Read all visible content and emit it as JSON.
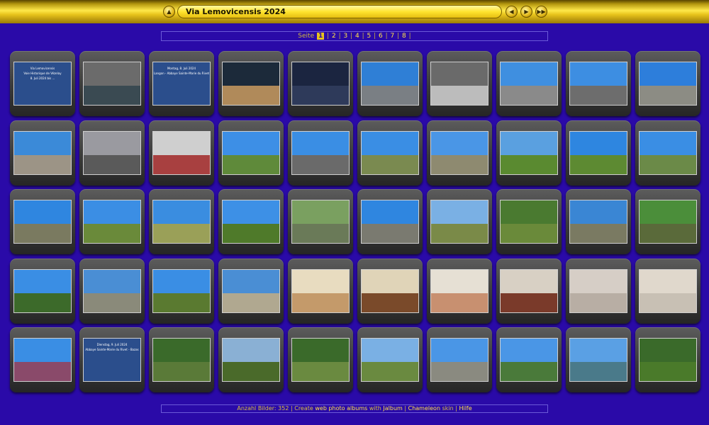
{
  "header": {
    "title": "Via Lemovicensis 2024",
    "up_icon": "up-arrow-icon",
    "prev_icon": "previous-icon",
    "play_icon": "play-icon",
    "next_icon": "next-icon"
  },
  "pager": {
    "label": "Seite",
    "current": "1",
    "pages": [
      "2",
      "3",
      "4",
      "5",
      "6",
      "7",
      "8"
    ]
  },
  "thumbnails": [
    {
      "kind": "title",
      "lines": [
        "Via Lemovicensis",
        "Voie Historique de Vézelay",
        "8. Juli 2024 bis ..."
      ],
      "sky": "#2b4e8c",
      "ground": "#2b4e8c"
    },
    {
      "kind": "photo",
      "sky": "#6b6b6b",
      "ground": "#3a4a52"
    },
    {
      "kind": "title",
      "lines": [
        "Montag, 8. Juli 2024",
        "Langon - Abbaye Sainte-Marie du Rivet"
      ],
      "sky": "#2b4e8c",
      "ground": "#2b4e8c"
    },
    {
      "kind": "photo",
      "sky": "#1c2a3a",
      "ground": "#b08a5a"
    },
    {
      "kind": "photo",
      "sky": "#1b2540",
      "ground": "#2e3a5a"
    },
    {
      "kind": "photo",
      "sky": "#2f7fd6",
      "ground": "#7a7f84"
    },
    {
      "kind": "photo",
      "sky": "#6a6a6a",
      "ground": "#bcbcbc"
    },
    {
      "kind": "photo",
      "sky": "#3f8fe0",
      "ground": "#8a8a8a"
    },
    {
      "kind": "photo",
      "sky": "#3d8ee2",
      "ground": "#6d6d6d"
    },
    {
      "kind": "photo",
      "sky": "#2d7edb",
      "ground": "#8c8c84"
    },
    {
      "kind": "photo",
      "sky": "#3b8ad8",
      "ground": "#9c9486"
    },
    {
      "kind": "photo",
      "sky": "#9a9aa0",
      "ground": "#5a5a5a"
    },
    {
      "kind": "photo",
      "sky": "#cfcfcf",
      "ground": "#a84040"
    },
    {
      "kind": "photo",
      "sky": "#3d8fe6",
      "ground": "#5f8a3a"
    },
    {
      "kind": "photo",
      "sky": "#3a8ee4",
      "ground": "#6a6a6a"
    },
    {
      "kind": "photo",
      "sky": "#3a8ee4",
      "ground": "#7a8a50"
    },
    {
      "kind": "photo",
      "sky": "#4a96e6",
      "ground": "#8e8a70"
    },
    {
      "kind": "photo",
      "sky": "#5aa0e0",
      "ground": "#5a8a30"
    },
    {
      "kind": "photo",
      "sky": "#2e86e0",
      "ground": "#5d8a32"
    },
    {
      "kind": "photo",
      "sky": "#3a8ee4",
      "ground": "#6b8a48"
    },
    {
      "kind": "photo",
      "sky": "#2f86e0",
      "ground": "#7a7a60"
    },
    {
      "kind": "photo",
      "sky": "#3b8ee4",
      "ground": "#6a8a3a"
    },
    {
      "kind": "photo",
      "sky": "#3a8de0",
      "ground": "#9aa058"
    },
    {
      "kind": "photo",
      "sky": "#3d90e6",
      "ground": "#4f7a2a"
    },
    {
      "kind": "photo",
      "sky": "#7aa060",
      "ground": "#6a7a58"
    },
    {
      "kind": "photo",
      "sky": "#2f86e0",
      "ground": "#7a7a70"
    },
    {
      "kind": "photo",
      "sky": "#7ab0e4",
      "ground": "#7a8a48"
    },
    {
      "kind": "photo",
      "sky": "#4a7a30",
      "ground": "#6a8a3a"
    },
    {
      "kind": "photo",
      "sky": "#3a86d4",
      "ground": "#7a7a62"
    },
    {
      "kind": "photo",
      "sky": "#4b8e3a",
      "ground": "#5a6a3a"
    },
    {
      "kind": "photo",
      "sky": "#3a8ee4",
      "ground": "#3c6a2a"
    },
    {
      "kind": "photo",
      "sky": "#4a8ed4",
      "ground": "#8a8a7a"
    },
    {
      "kind": "photo",
      "sky": "#3a8ee4",
      "ground": "#5a7a30"
    },
    {
      "kind": "photo",
      "sky": "#4a8ed4",
      "ground": "#b0a890"
    },
    {
      "kind": "photo",
      "sky": "#e8dcc0",
      "ground": "#c49a6a"
    },
    {
      "kind": "photo",
      "sky": "#e0d4b8",
      "ground": "#7a4a2a"
    },
    {
      "kind": "photo",
      "sky": "#e6e0d4",
      "ground": "#c89070"
    },
    {
      "kind": "photo",
      "sky": "#d8d0c4",
      "ground": "#7a3a2a"
    },
    {
      "kind": "photo",
      "sky": "#d6cec6",
      "ground": "#b8aea4"
    },
    {
      "kind": "photo",
      "sky": "#e0d8cc",
      "ground": "#c8c0b4"
    },
    {
      "kind": "photo",
      "sky": "#3a8ee4",
      "ground": "#8a4a6a"
    },
    {
      "kind": "title",
      "lines": [
        "Dienstag, 9. Juli 2024",
        "Abbaye Sainte-Marie du Rivet - Bazas"
      ],
      "sky": "#2b4e8c",
      "ground": "#2b4e8c"
    },
    {
      "kind": "photo",
      "sky": "#3a6a2a",
      "ground": "#5a7a38"
    },
    {
      "kind": "photo",
      "sky": "#8ab0d4",
      "ground": "#4a6a2a"
    },
    {
      "kind": "photo",
      "sky": "#3a6a2a",
      "ground": "#6a8a40"
    },
    {
      "kind": "photo",
      "sky": "#7ab0e4",
      "ground": "#6a8a40"
    },
    {
      "kind": "photo",
      "sky": "#4a96e6",
      "ground": "#8a8a80"
    },
    {
      "kind": "photo",
      "sky": "#4a96e6",
      "ground": "#4a7a3a"
    },
    {
      "kind": "photo",
      "sky": "#5aa0e4",
      "ground": "#4a7a8a"
    },
    {
      "kind": "photo",
      "sky": "#3a6a2a",
      "ground": "#4a7a2a"
    }
  ],
  "footer": {
    "count_label": "Anzahl Bilder:",
    "count": "352",
    "create_label": "Create",
    "link1": "web photo albums",
    "with": "with",
    "link2": "Jalbum",
    "skin": "Chameleon",
    "skin_suffix": "skin",
    "help": "Hilfe"
  }
}
